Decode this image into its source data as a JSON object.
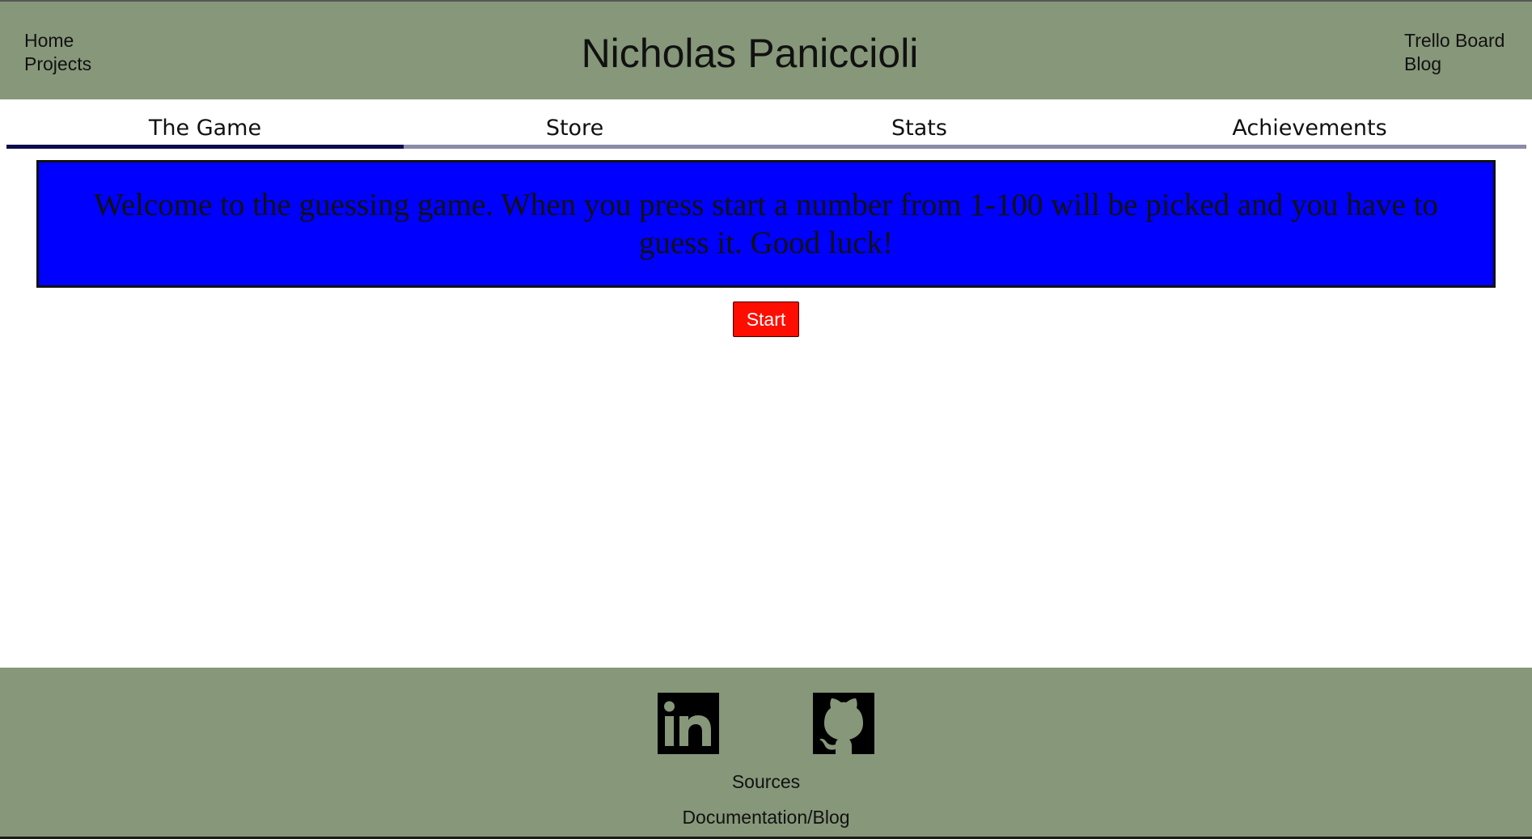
{
  "header": {
    "title": "Nicholas Paniccioli",
    "left_links": [
      "Home",
      "Projects"
    ],
    "right_links": [
      "Trello Board",
      "Blog"
    ],
    "background_color": "#87977a"
  },
  "tabs": [
    {
      "label": "The Game",
      "active": true
    },
    {
      "label": "Store",
      "active": false
    },
    {
      "label": "Stats",
      "active": false
    },
    {
      "label": "Achievements",
      "active": false
    }
  ],
  "main": {
    "welcome_text": "Welcome to the guessing game. When you press start a number from 1-100 will be picked and you have to guess it. Good luck!",
    "welcome_box_color": "#0000ff",
    "start_label": "Start",
    "start_color": "#ff0d00"
  },
  "footer": {
    "icons": [
      "linkedin-icon",
      "github-icon"
    ],
    "sources_label": "Sources",
    "docs_label": "Documentation/Blog"
  }
}
